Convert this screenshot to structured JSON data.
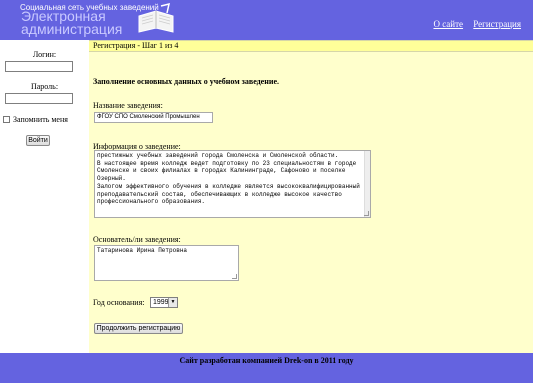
{
  "header": {
    "logo_small": "Социальная сеть учебных заведений",
    "logo_line1": "Электронная",
    "logo_line2": "администрация",
    "nav": [
      "О сайте",
      "Регистрация"
    ]
  },
  "sidebar": {
    "login_label": "Логин:",
    "password_label": "Пароль:",
    "remember_label": "Запомнить меня",
    "login_button": "Войти"
  },
  "main": {
    "step_title": "Регистрация - Шаг 1 из 4",
    "heading": "Заполнение основных данных о учебном заведение.",
    "name_label": "Название заведения:",
    "name_value": "ФГОУ СПО Смоленский Промышлен",
    "info_label": "Информация о заведение:",
    "info_value": "престижных учебных заведений города Смоленска и Смоленской области.\nВ настоящее время колледж ведет подготовку по 23 специальностям в городе Смоленске и своих филиалах в городах Калининграде, Сафоново и поселке Озерный.\nЗалогом эффективного обучения в колледже является высококвалифицированный преподавательский состав, обеспечивающих в колледже высокое качество профессионального образования.",
    "founder_label": "Основатель/ли заведения:",
    "founder_value": "Татаринова Ирина Петровна",
    "year_label": "Год основания:",
    "year_value": "1999",
    "continue_button": "Продолжить регистрацию"
  },
  "footer": {
    "text": "Сайт разработан компанией Drek-on в 2011 году"
  },
  "colors": {
    "header_bg": "#6463e0",
    "main_bg": "#ffffcc",
    "step_bg": "#ffff99"
  }
}
